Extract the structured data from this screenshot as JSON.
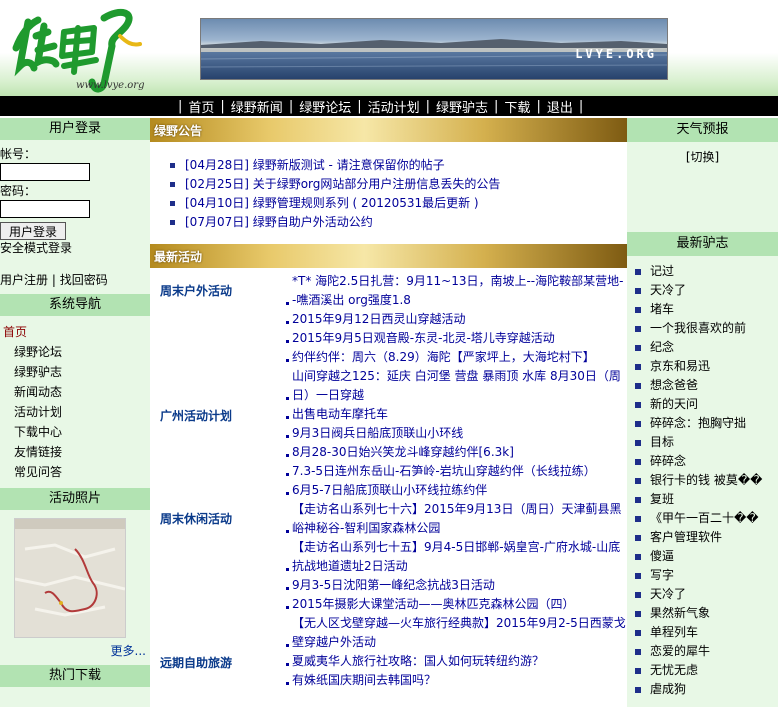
{
  "header": {
    "logo_url_text": "www.lvye.org",
    "banner_text": "LVYE.ORG"
  },
  "nav": {
    "items": [
      "首页",
      "绿野新闻",
      "绿野论坛",
      "活动计划",
      "绿野驴志",
      "下载",
      "退出"
    ]
  },
  "login": {
    "title": "用户登录",
    "account_label": "帐号：",
    "password_label": "密码：",
    "submit_label": "用户登录",
    "safe_mode": "安全模式登录",
    "register": "用户注册",
    "separator": "|",
    "find_password": "找回密码"
  },
  "system_nav": {
    "title": "系统导航",
    "items": [
      "首页",
      "绿野论坛",
      "绿野驴志",
      "新闻动态",
      "活动计划",
      "下载中心",
      "友情链接",
      "常见问答"
    ]
  },
  "photos": {
    "title": "活动照片",
    "more": "更多..."
  },
  "hot_downloads": {
    "title": "热门下载"
  },
  "announcement": {
    "title": "绿野公告",
    "items": [
      "[04月28日] 绿野新版测试 - 请注意保留你的帖子",
      "[02月25日] 关于绿野org网站部分用户注册信息丢失的公告",
      "[04月10日] 绿野管理规则系列 ( 20120531最后更新 )",
      "[07月07日] 绿野自助户外活动公约"
    ]
  },
  "latest": {
    "title": "最新活动",
    "groups": [
      {
        "name": "周末户外活动",
        "events": [
          "*T* 海陀2.5日扎营：9月11~13日，南坡上--海陀鞍部某营地--噍酒溪出 org强度1.8",
          "2015年9月12日西灵山穿越活动",
          "2015年9月5日观音殿-东灵-北灵-塔儿寺穿越活动",
          "约伴约伴：周六（8.29）海陀【严家坪上，大海坨村下】",
          "山间穿越之125：延庆 白河堡 营盘 暴雨顶 水库 8月30日（周日）一日穿越"
        ]
      },
      {
        "name": "广州活动计划",
        "events": [
          "出售电动车摩托车",
          "9月3日阀兵日船底顶联山小环线",
          "8月28-30日始兴笑龙斗峰穿越约伴[6.3k]",
          "7.3-5日连州东岳山-石笋岭-岩坑山穿越约伴（长线拉练）",
          "6月5-7日船底顶联山小环线拉练约伴"
        ]
      },
      {
        "name": "周末休闲活动",
        "events": [
          "【走访名山系列七十六】2015年9月13日（周日）天津蓟县黑峪神秘谷-智利国家森林公园",
          "【走访名山系列七十五】9月4-5日邯郸-娲皇宫-广府水城-山底抗战地道遗址2日活动",
          "9月3-5日沈阳第一峰纪念抗战3日活动",
          "2015年摄影大课堂活动——奥林匹克森林公园（四）",
          "【无人区戈壁穿越—火车旅行经典款】2015年9月2-5日西蒙戈壁穿越户外活动"
        ]
      },
      {
        "name": "远期自助旅游",
        "events": [
          "夏威夷华人旅行社攻略：国人如何玩转纽约游？",
          "有姝纸国庆期间去韩国吗？"
        ]
      }
    ]
  },
  "weather": {
    "title": "天气预报",
    "switch_label": "[切换]"
  },
  "latest_posts": {
    "title": "最新驴志",
    "items": [
      "记过",
      "天冷了",
      "堵车",
      "一个我很喜欢的前",
      "纪念",
      "京东和易迅",
      "想念爸爸",
      "新的天问",
      "碎碎念：抱胸守拙",
      "目标",
      "碎碎念",
      "银行卡的钱 被莫��",
      "复班",
      "《甲午一百二十��",
      "客户管理软件",
      "傻逼",
      "写字",
      "天冷了",
      "果然新气象",
      "单程列车",
      "恋爱的犀牛",
      "无忧无虑",
      "虐成狗"
    ]
  },
  "colors": {
    "nav_bg": "#000000",
    "side_header": "#b2e3b2",
    "side_bg": "#e8f8e6",
    "link_blue": "#000099",
    "group_blue": "#0a3a8a"
  }
}
